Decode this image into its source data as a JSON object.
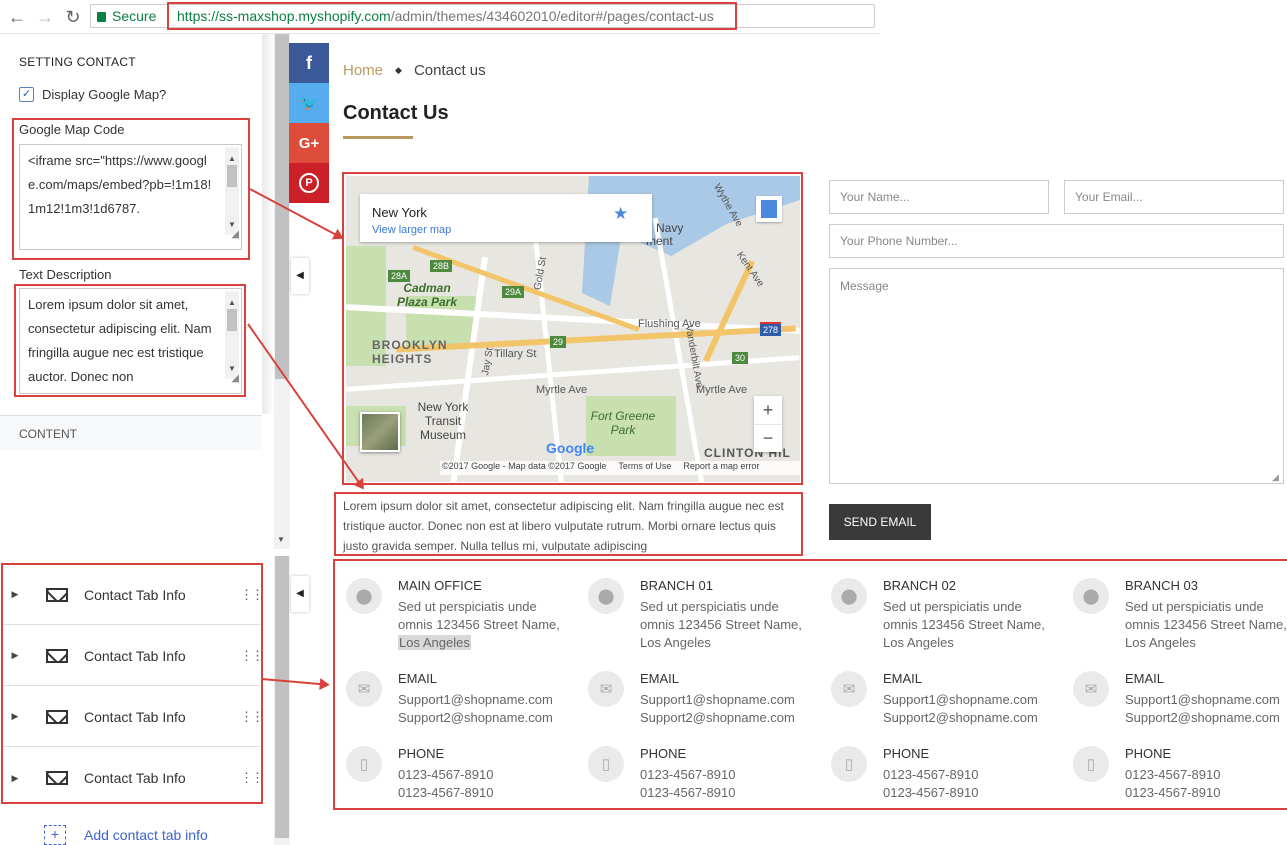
{
  "browser": {
    "back_icon": "arrow-left-icon",
    "forward_icon": "arrow-right-icon",
    "reload_icon": "reload-icon",
    "secure_label": "Secure",
    "url_host": "https://ss-maxshop.myshopify.com",
    "url_path": "/admin/themes/434602010/editor#/pages/contact-us"
  },
  "sidebar": {
    "section_title": "SETTING CONTACT",
    "display_map_label": "Display Google Map?",
    "display_map_checked": true,
    "map_code_label": "Google Map Code",
    "map_code_value": "<iframe src=\"https://www.google.com/maps/embed?pb=!1m18!1m12!1m3!1d6787.",
    "text_desc_label": "Text Description",
    "text_desc_value": "Lorem ipsum dolor sit amet, consectetur adipiscing elit. Nam fringilla augue nec est tristique auctor. Donec non",
    "content_heading": "CONTENT",
    "tabs": [
      {
        "label": "Contact Tab Info"
      },
      {
        "label": "Contact Tab Info"
      },
      {
        "label": "Contact Tab Info"
      },
      {
        "label": "Contact Tab Info"
      }
    ],
    "add_label": "Add contact tab info"
  },
  "social": [
    {
      "icon": "facebook-icon",
      "glyph": "f",
      "color": "#3b5998"
    },
    {
      "icon": "twitter-icon",
      "glyph": "🐦",
      "color": "#55acee"
    },
    {
      "icon": "google-plus-icon",
      "glyph": "G+",
      "color": "#dd4b39"
    },
    {
      "icon": "pinterest-icon",
      "glyph": "P",
      "color": "#cb2027"
    }
  ],
  "page": {
    "breadcrumb_home": "Home",
    "breadcrumb_sep": "◆",
    "breadcrumb_current": "Contact us",
    "title": "Contact Us",
    "accent_color": "#b89a5e",
    "description": "Lorem ipsum dolor sit amet, consectetur adipiscing elit. Nam fringilla augue nec est tristique auctor. Donec non est at libero vulputate rutrum. Morbi ornare lectus quis justo gravida semper. Nulla tellus mi, vulputate adipiscing"
  },
  "map": {
    "place": "New York",
    "larger_link": "View larger map",
    "labels": {
      "cadman": "Cadman Plaza Park",
      "brooklyn": "BROOKLYN HEIGHTS",
      "museum": "New York Transit Museum",
      "fortgreene": "Fort Greene Park",
      "flushing": "Flushing Ave",
      "myrtle": "Myrtle Ave",
      "myrtle2": "Myrtle Ave",
      "tillary": "Tillary St",
      "navy": "n Navy ment",
      "clinton": "CLINTON HIL",
      "jay": "Jay St",
      "gold": "Gold St",
      "vanderbilt": "Vanderbilt Ave",
      "kent": "Kent Ave",
      "wythe": "Wythe Ave"
    },
    "shields": [
      "28A",
      "28B",
      "29A",
      "29",
      "30",
      "278"
    ],
    "zoom_in": "+",
    "zoom_out": "−",
    "google": "Google",
    "attribution": "©2017 Google - Map data ©2017 Google",
    "terms": "Terms of Use",
    "report": "Report a map error"
  },
  "form": {
    "name_placeholder": "Your Name...",
    "email_placeholder": "Your Email...",
    "phone_placeholder": "Your Phone Number...",
    "message_placeholder": "Message",
    "send_label": "SEND EMAIL"
  },
  "offices": [
    {
      "title": "MAIN OFFICE",
      "addr1": "Sed ut perspiciatis unde",
      "addr2": "omnis 123456 Street Name,",
      "addr3": "Los Angeles",
      "email_title": "EMAIL",
      "email1": "Support1@shopname.com",
      "email2": "Support2@shopname.com",
      "phone_title": "PHONE",
      "phone1": "0123-4567-8910",
      "phone2": "0123-4567-8910"
    },
    {
      "title": "BRANCH 01",
      "addr1": "Sed ut perspiciatis unde",
      "addr2": "omnis 123456 Street Name,",
      "addr3": "Los Angeles",
      "email_title": "EMAIL",
      "email1": "Support1@shopname.com",
      "email2": "Support2@shopname.com",
      "phone_title": "PHONE",
      "phone1": "0123-4567-8910",
      "phone2": "0123-4567-8910"
    },
    {
      "title": "BRANCH 02",
      "addr1": "Sed ut perspiciatis unde",
      "addr2": "omnis 123456 Street Name,",
      "addr3": "Los Angeles",
      "email_title": "EMAIL",
      "email1": "Support1@shopname.com",
      "email2": "Support2@shopname.com",
      "phone_title": "PHONE",
      "phone1": "0123-4567-8910",
      "phone2": "0123-4567-8910"
    },
    {
      "title": "BRANCH 03",
      "addr1": "Sed ut perspiciatis unde",
      "addr2": "omnis 123456 Street Name,",
      "addr3": "Los Angeles",
      "email_title": "EMAIL",
      "email1": "Support1@shopname.com",
      "email2": "Support2@shopname.com",
      "phone_title": "PHONE",
      "phone1": "0123-4567-8910",
      "phone2": "0123-4567-8910"
    }
  ],
  "colors": {
    "annotation_red": "#d9423c",
    "send_button": "#3a3a3a",
    "link_blue": "#3d63c9"
  }
}
